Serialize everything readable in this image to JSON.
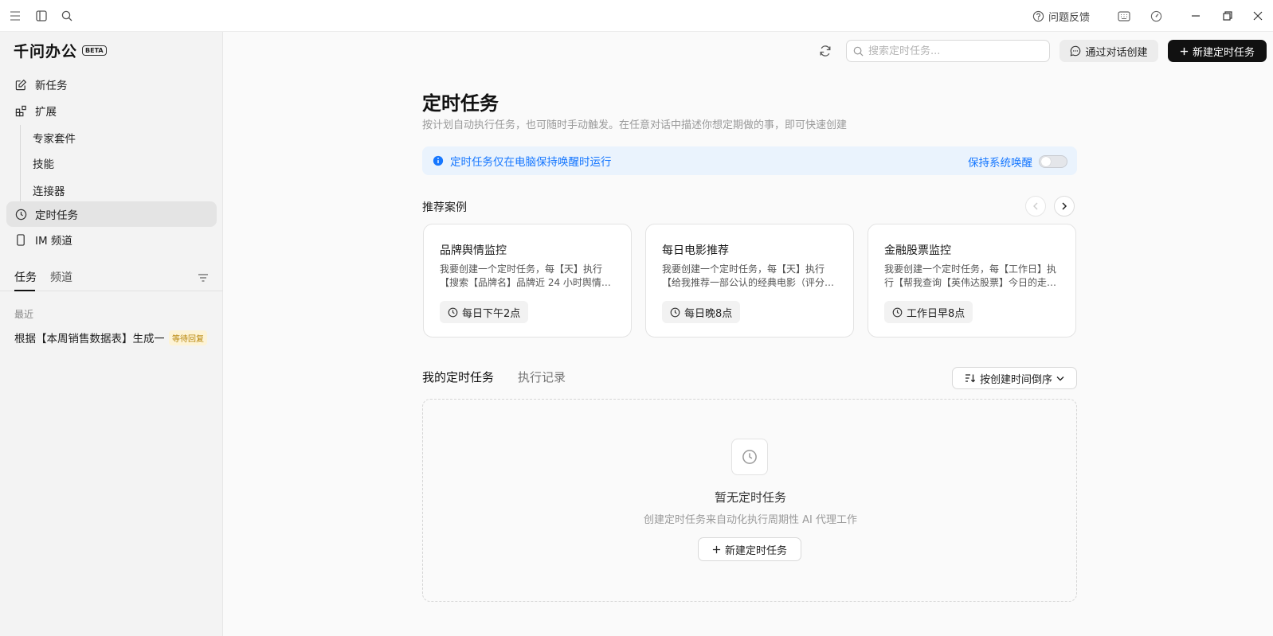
{
  "titlebar": {
    "feedback_label": "问题反馈",
    "icons": [
      "menu-icon",
      "sidebar-toggle-icon",
      "search-icon",
      "help-icon",
      "keyboard-icon",
      "gauge-icon",
      "minimize-icon",
      "restore-icon",
      "close-icon"
    ]
  },
  "sidebar": {
    "brand": "千问办公",
    "badge": "BETA",
    "nav": {
      "new_task": "新任务",
      "extensions": "扩展",
      "expert_suite": "专家套件",
      "skills": "技能",
      "connectors": "连接器",
      "scheduled": "定时任务",
      "im_channel": "IM 频道"
    },
    "tabs": {
      "tasks": "任务",
      "channels": "频道"
    },
    "recent_label": "最近",
    "recent_item": "根据【本周销售数据表】生成一份",
    "recent_badge": "等待回复"
  },
  "toolbar": {
    "search_placeholder": "搜索定时任务...",
    "chat_create": "通过对话创建",
    "new_task": "新建定时任务"
  },
  "main": {
    "title": "定时任务",
    "subtitle": "按计划自动执行任务，也可随时手动触发。在任意对话中描述你想定期做的事，即可快速创建",
    "notice": "定时任务仅在电脑保持唤醒时运行",
    "keep_awake": "保持系统唤醒",
    "recommended_label": "推荐案例",
    "cards": [
      {
        "title": "品牌舆情监控",
        "desc": "我要创建一个定时任务，每【天】执行【搜索【品牌名】品牌近 24 小时舆情…",
        "schedule": "每日下午2点"
      },
      {
        "title": "每日电影推荐",
        "desc": "我要创建一个定时任务，每【天】执行【给我推荐一部公认的经典电影（评分…",
        "schedule": "每日晚8点"
      },
      {
        "title": "金融股票监控",
        "desc": "我要创建一个定时任务，每【工作日】执行【帮我查询【英伟达股票】今日的走…",
        "schedule": "工作日早8点"
      }
    ],
    "tabs": {
      "mine": "我的定时任务",
      "history": "执行记录"
    },
    "sort_label": "按创建时间倒序",
    "empty_title": "暂无定时任务",
    "empty_sub": "创建定时任务来自动化执行周期性 AI 代理工作",
    "empty_button": "新建定时任务"
  },
  "colors": {
    "accent": "#1677ff",
    "primary_button": "#111111",
    "badge": "#b8860b"
  }
}
